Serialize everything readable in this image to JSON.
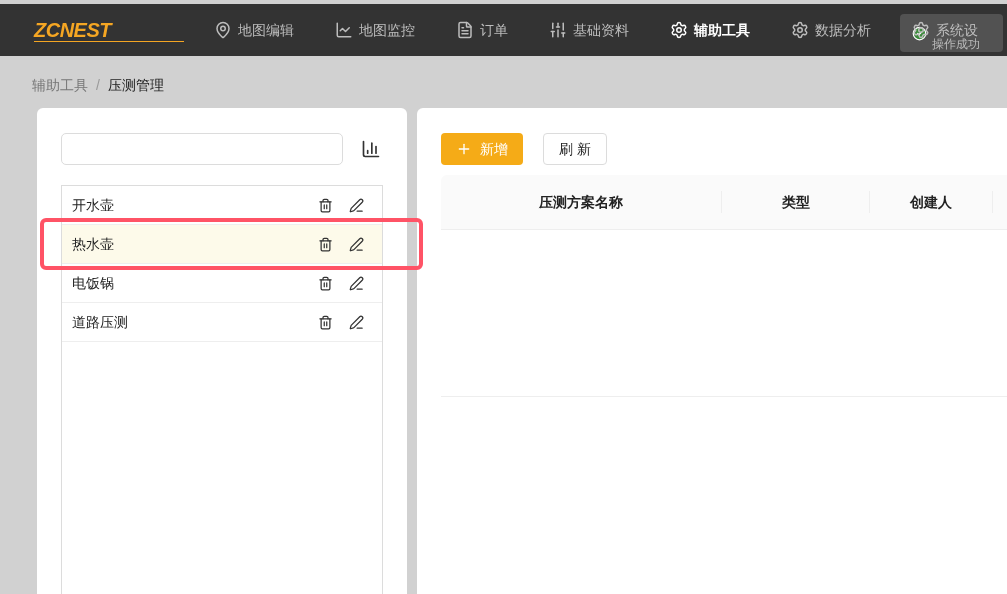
{
  "logo": "ZCNEST",
  "nav": [
    {
      "label": "地图编辑",
      "selected": false
    },
    {
      "label": "地图监控",
      "selected": false
    },
    {
      "label": "订单",
      "selected": false
    },
    {
      "label": "基础资料",
      "selected": false
    },
    {
      "label": "辅助工具",
      "selected": true
    },
    {
      "label": "数据分析",
      "selected": false
    },
    {
      "label": "系统设",
      "selected": false
    }
  ],
  "toast": {
    "message": "操作成功"
  },
  "breadcrumb": {
    "items": [
      "辅助工具",
      "压测管理"
    ],
    "separator": "/"
  },
  "plans": [
    {
      "name": "开水壶",
      "selected": false
    },
    {
      "name": "热水壶",
      "selected": true
    },
    {
      "name": "电饭锅",
      "selected": false
    },
    {
      "name": "道路压测",
      "selected": false
    }
  ],
  "buttons": {
    "add": "新增",
    "refresh": "刷 新"
  },
  "table": {
    "columns": [
      "压测方案名称",
      "类型",
      "创建人"
    ]
  }
}
